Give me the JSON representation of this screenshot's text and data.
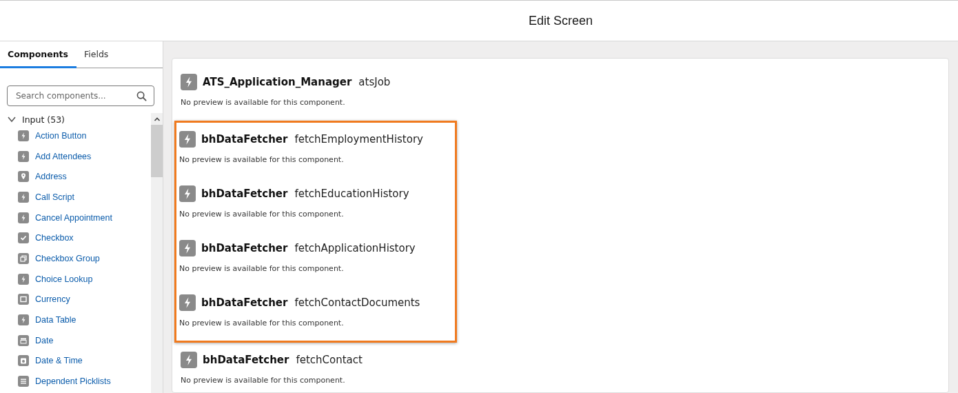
{
  "header": {
    "title": "Edit Screen"
  },
  "tabs": [
    {
      "label": "Components",
      "selected": true
    },
    {
      "label": "Fields",
      "selected": false
    }
  ],
  "search": {
    "placeholder": "Search components..."
  },
  "palette": {
    "section": {
      "label": "Input (53)",
      "expanded": true
    },
    "items": [
      {
        "label": "Action Button",
        "kind": "bolt"
      },
      {
        "label": "Add Attendees",
        "kind": "bolt"
      },
      {
        "label": "Address",
        "kind": "pin"
      },
      {
        "label": "Call Script",
        "kind": "bolt"
      },
      {
        "label": "Cancel Appointment",
        "kind": "bolt"
      },
      {
        "label": "Checkbox",
        "kind": "check"
      },
      {
        "label": "Checkbox Group",
        "kind": "checkgroup"
      },
      {
        "label": "Choice Lookup",
        "kind": "bolt"
      },
      {
        "label": "Currency",
        "kind": "currency"
      },
      {
        "label": "Data Table",
        "kind": "bolt"
      },
      {
        "label": "Date",
        "kind": "calendar"
      },
      {
        "label": "Date & Time",
        "kind": "calendartime"
      },
      {
        "label": "Dependent Picklists",
        "kind": "list"
      }
    ]
  },
  "canvas": {
    "components": [
      {
        "name": "ATS_Application_Manager",
        "api_name": "atsJob",
        "note": "No preview is available for this component.",
        "highlighted": false
      },
      {
        "name": "bhDataFetcher",
        "api_name": "fetchEmploymentHistory",
        "note": "No preview is available for this component.",
        "highlighted": true
      },
      {
        "name": "bhDataFetcher",
        "api_name": "fetchEducationHistory",
        "note": "No preview is available for this component.",
        "highlighted": true
      },
      {
        "name": "bhDataFetcher",
        "api_name": "fetchApplicationHistory",
        "note": "No preview is available for this component.",
        "highlighted": true
      },
      {
        "name": "bhDataFetcher",
        "api_name": "fetchContactDocuments",
        "note": "No preview is available for this component.",
        "highlighted": true
      },
      {
        "name": "bhDataFetcher",
        "api_name": "fetchContact",
        "note": "No preview is available for this component.",
        "highlighted": false
      }
    ]
  }
}
